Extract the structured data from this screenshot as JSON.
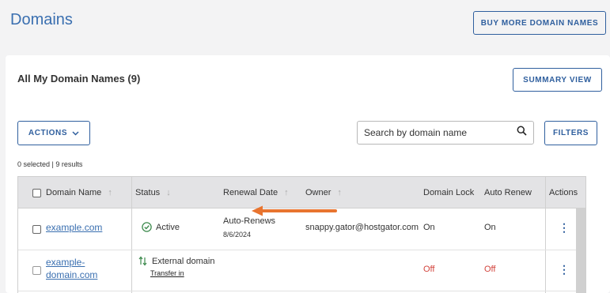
{
  "header": {
    "title": "Domains",
    "buy_button": "BUY MORE DOMAIN NAMES"
  },
  "card": {
    "title": "All My Domain Names (9)",
    "summary_button": "SUMMARY VIEW",
    "actions_button": "ACTIONS",
    "search_placeholder": "Search by domain name",
    "filters_button": "FILTERS",
    "results_text": "0 selected | 9 results"
  },
  "table": {
    "columns": {
      "domain": "Domain Name",
      "status": "Status",
      "renewal": "Renewal Date",
      "owner": "Owner",
      "lock": "Domain Lock",
      "autorenew": "Auto Renew",
      "actions": "Actions"
    },
    "rows": [
      {
        "domain": "example.com",
        "status": "Active",
        "renewal_label": "Auto-Renews",
        "renewal_date": "8/6/2024",
        "owner": "snappy.gator@hostgator.com",
        "lock": "On",
        "autorenew": "On"
      },
      {
        "domain_line1": "example-",
        "domain_line2": "domain.com",
        "status": "External domain",
        "status_link": "Transfer in",
        "lock": "Off",
        "autorenew": "Off"
      }
    ]
  },
  "colors": {
    "accent": "#2f5f9e",
    "title": "#3a6fb0",
    "off": "#d2433c",
    "arrow": "#e8742f",
    "active": "#3d8a4d"
  },
  "icons": [
    "chevron-down-icon",
    "search-icon",
    "sort-arrow-icon",
    "check-circle-icon",
    "transfer-icon",
    "kebab-menu-icon",
    "arrow-left-icon"
  ]
}
